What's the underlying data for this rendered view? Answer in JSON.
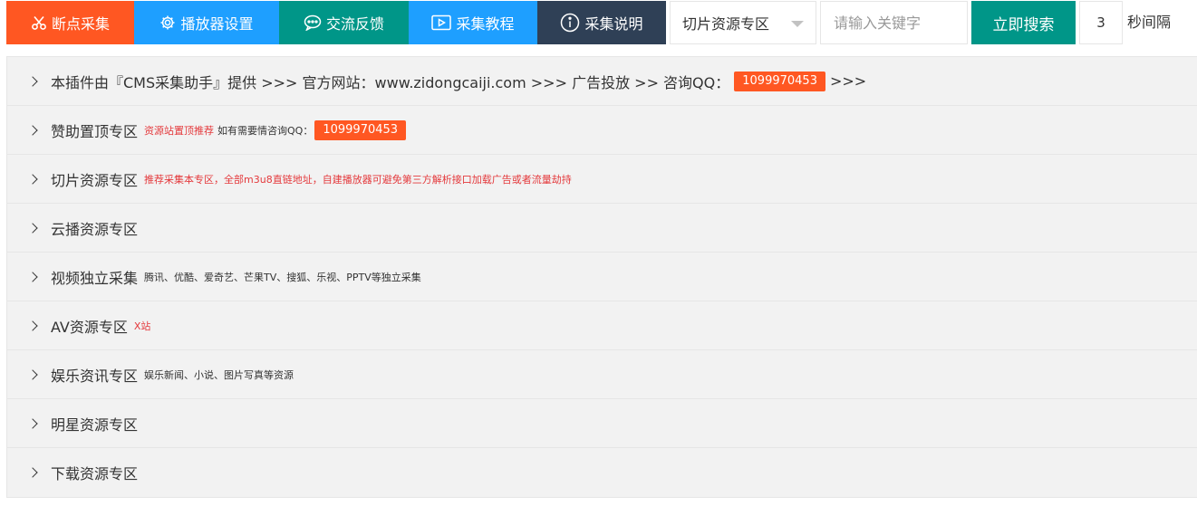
{
  "toolbar": {
    "buttons": [
      {
        "label": "断点采集",
        "icon": "scissors-icon",
        "color": "#ff5722"
      },
      {
        "label": "播放器设置",
        "icon": "gear-icon",
        "color": "#1e9fff"
      },
      {
        "label": "交流反馈",
        "icon": "chat-bubble-icon",
        "color": "#009688"
      },
      {
        "label": "采集教程",
        "icon": "video-play-icon",
        "color": "#1e9fff"
      },
      {
        "label": "采集说明",
        "icon": "info-icon",
        "color": "#2f4056"
      }
    ],
    "select_value": "切片资源专区",
    "search_placeholder": "请输入关键字",
    "search_label": "立即搜索",
    "interval_value": "3",
    "interval_label": "秒间隔"
  },
  "info_row": {
    "text_before": "本插件由『CMS采集助手』提供 >>> 官方网站：www.zidongcaiji.com >>> 广告投放 >> 咨询QQ：",
    "qq": "1099970453",
    "text_after": ">>>"
  },
  "rows": [
    {
      "title": "赞助置顶专区",
      "note": "资源站置顶推荐",
      "note2": "如有需要情咨询QQ：",
      "badge": "1099970453"
    },
    {
      "title": "切片资源专区",
      "note": "推荐采集本专区，全部m3u8直链地址，自建播放器可避免第三方解析接口加载广告或者流量劫持"
    },
    {
      "title": "云播资源专区"
    },
    {
      "title": "视频独立采集",
      "note": "腾讯、优酷、爱奇艺、芒果TV、搜狐、乐视、PPTV等独立采集"
    },
    {
      "title": "AV资源专区",
      "note": "X站"
    },
    {
      "title": "娱乐资讯专区",
      "note": "娱乐新闻、小说、图片写真等资源"
    },
    {
      "title": "明星资源专区"
    },
    {
      "title": "下载资源专区"
    }
  ]
}
